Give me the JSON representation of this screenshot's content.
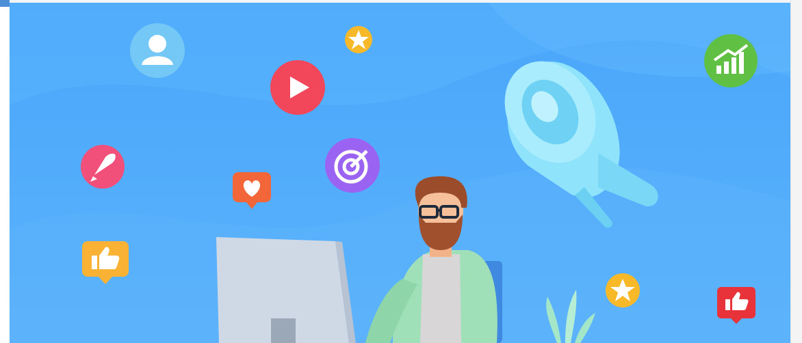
{
  "scene": {
    "description_icons": [
      "user-icon",
      "star-icon",
      "play-icon",
      "growth-chart-icon",
      "megaphone-icon",
      "rocket-icon",
      "target-icon",
      "heart-bubble-icon",
      "thumbs-up-icon",
      "thumbs-up-red-icon",
      "star-icon-bottom"
    ],
    "colors": {
      "background": "#4aa6fb",
      "user_badge": "#74c8f5",
      "star_badge": "#f7b928",
      "play_badge": "#f2465a",
      "growth_badge": "#5fc044",
      "rocket_badge": "#f0507a",
      "target_badge": "#9a63f2",
      "heart_bubble": "#f2663a",
      "thumbs_bubble": "#f9b233",
      "thumbs_red_bubble": "#e8333a",
      "megaphone": "#8fe3fb",
      "shirt": "#9fe0b8",
      "hair": "#9b4c2a",
      "monitor": "#cfd9e6"
    }
  }
}
